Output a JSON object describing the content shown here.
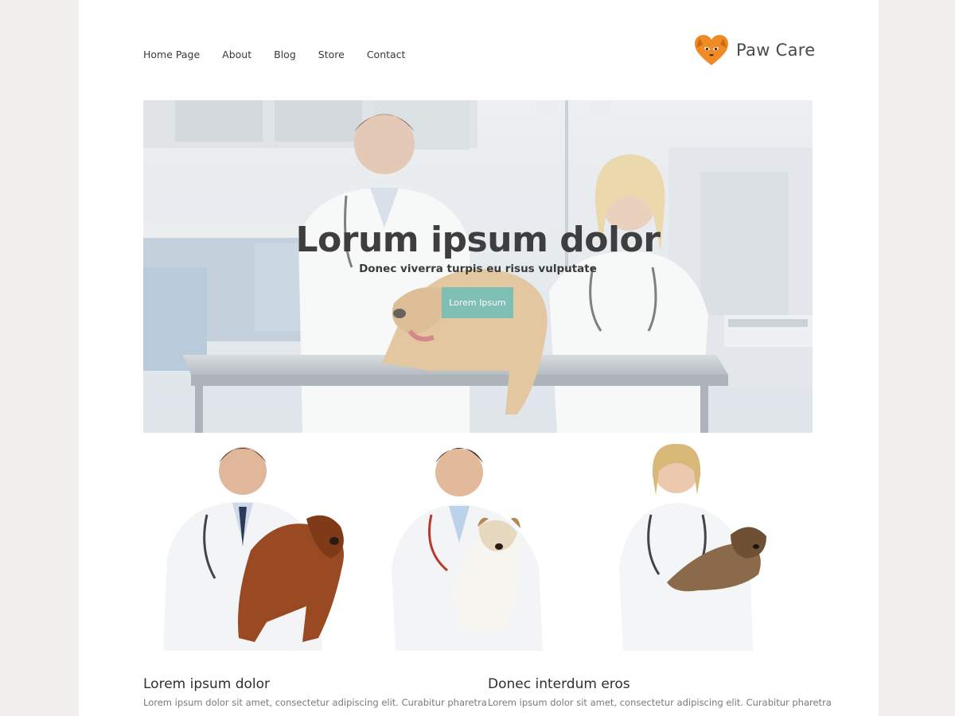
{
  "nav": {
    "items": [
      "Home Page",
      "About",
      "Blog",
      "Store",
      "Contact"
    ]
  },
  "logo": {
    "text": "Paw Care",
    "icon": "heart-dog-icon",
    "color": "#f08a24"
  },
  "hero": {
    "title": "Lorum ipsum dolor",
    "subtitle": "Donec viverra turpis eu risus vulputate",
    "button": "Lorem Ipsum",
    "button_color": "#7fbeb2"
  },
  "cards": [
    {
      "image": "vet-with-brown-spaniel"
    },
    {
      "image": "vet-with-terrier"
    },
    {
      "image": "vet-with-yorkie"
    }
  ],
  "columns": [
    {
      "title": "Lorem ipsum dolor",
      "text": "Lorem ipsum dolor sit amet, consectetur adipiscing elit. Curabitur pharetra"
    },
    {
      "title": "Donec interdum eros",
      "text": "Lorem ipsum dolor sit amet, consectetur adipiscing elit. Curabitur pharetra"
    }
  ]
}
